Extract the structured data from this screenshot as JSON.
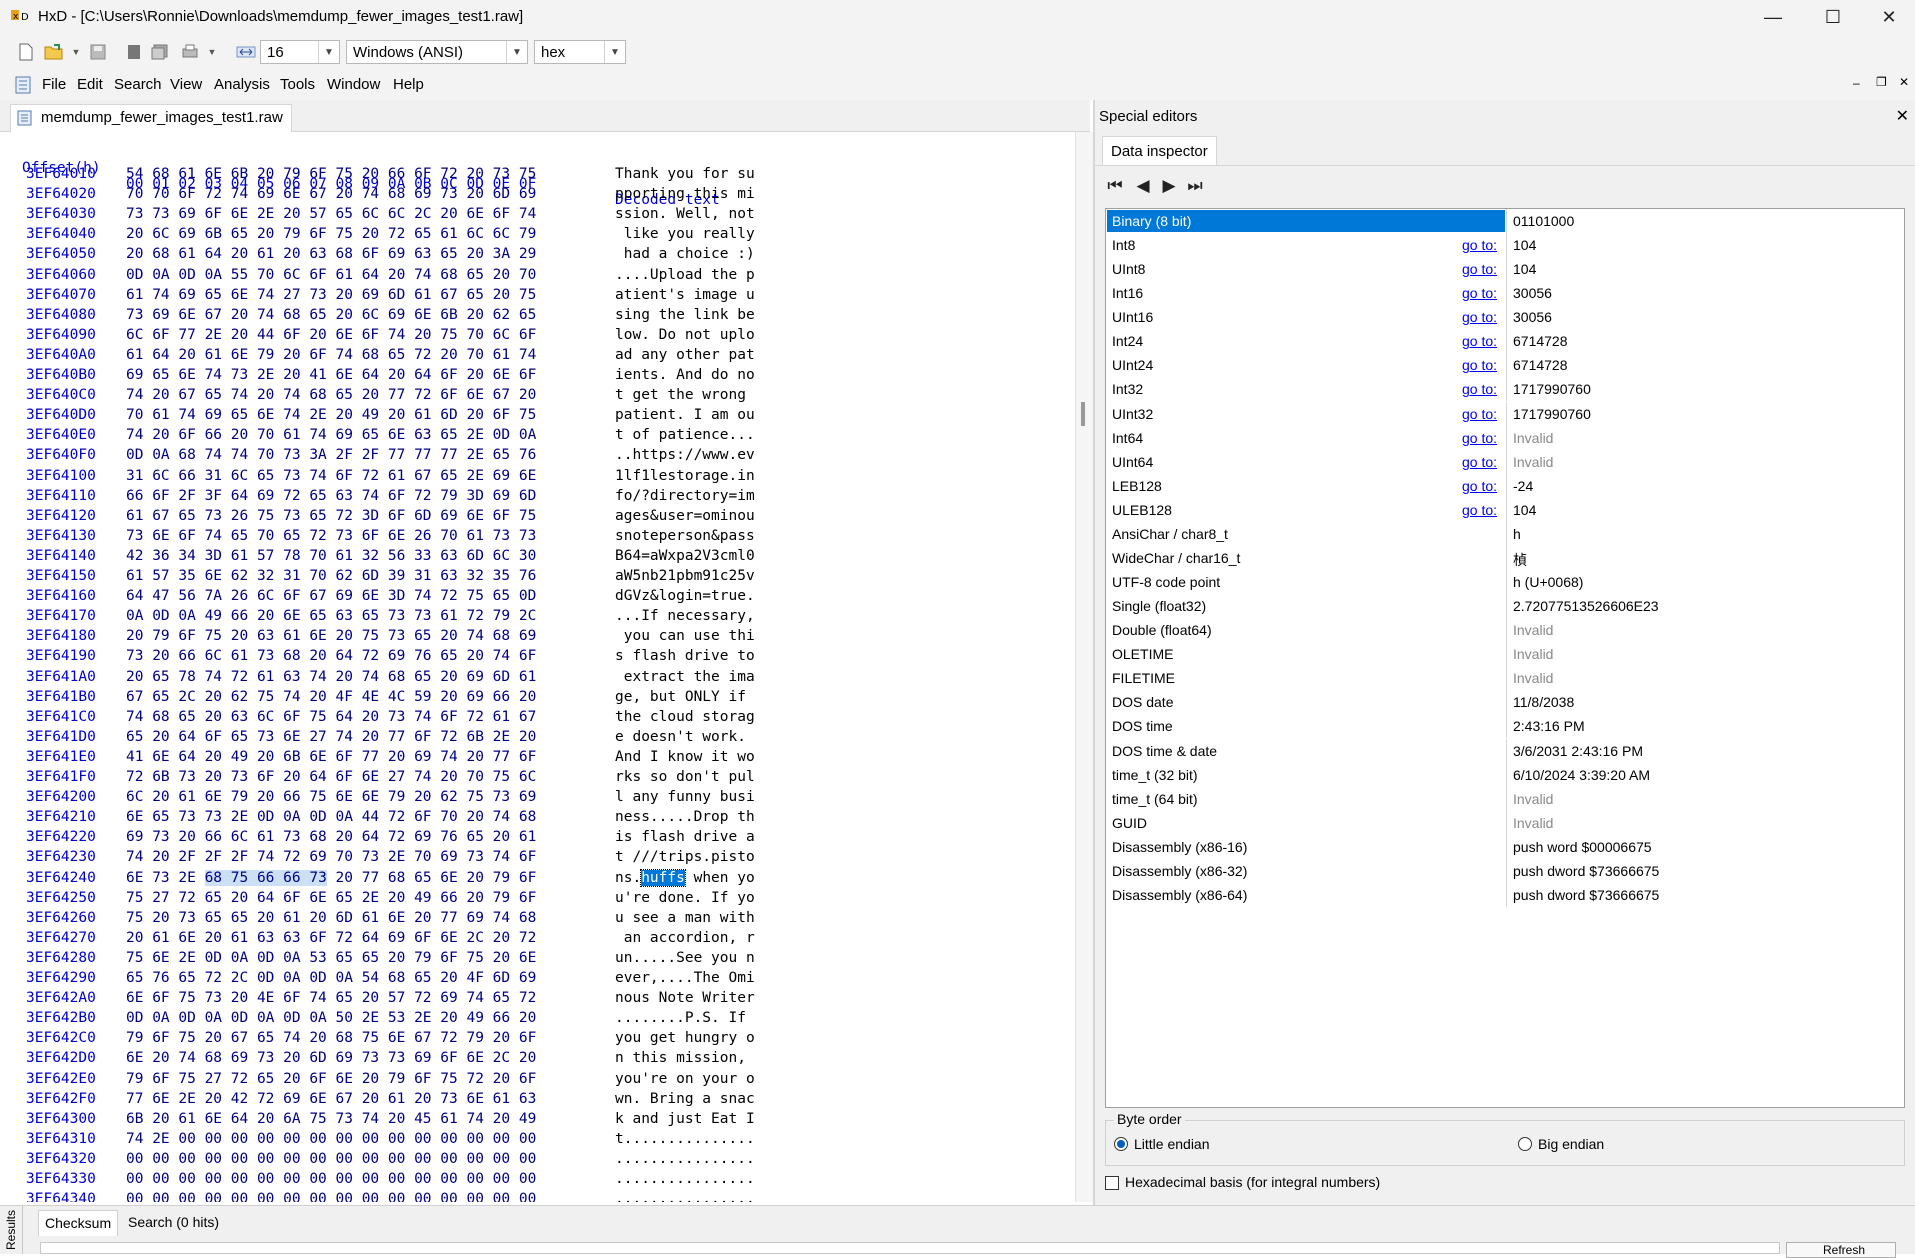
{
  "window": {
    "title": "HxD - [C:\\Users\\Ronnie\\Downloads\\memdump_fewer_images_test1.raw]",
    "minimize": "—",
    "maximize": "☐",
    "close": "✕"
  },
  "toolbar": {
    "bytes_per_row": "16",
    "charset": "Windows (ANSI)",
    "display_mode": "hex"
  },
  "menu": [
    "File",
    "Edit",
    "Search",
    "View",
    "Analysis",
    "Tools",
    "Window",
    "Help"
  ],
  "doc_tab": "memdump_fewer_images_test1.raw",
  "hex": {
    "offset_header": "Offset(h)",
    "column_headers": [
      "00",
      "01",
      "02",
      "03",
      "04",
      "05",
      "06",
      "07",
      "08",
      "09",
      "0A",
      "0B",
      "0C",
      "0D",
      "0E",
      "0F"
    ],
    "decoded_header": "Decoded text",
    "rows": [
      {
        "offset": "3EF64010",
        "hex": "54 68 61 6E 6B 20 79 6F 75 20 66 6F 72 20 73 75",
        "text": "Thank you for su"
      },
      {
        "offset": "3EF64020",
        "hex": "70 70 6F 72 74 69 6E 67 20 74 68 69 73 20 6D 69",
        "text": "pporting this mi"
      },
      {
        "offset": "3EF64030",
        "hex": "73 73 69 6F 6E 2E 20 57 65 6C 6C 2C 20 6E 6F 74",
        "text": "ssion. Well, not"
      },
      {
        "offset": "3EF64040",
        "hex": "20 6C 69 6B 65 20 79 6F 75 20 72 65 61 6C 6C 79",
        "text": " like you really"
      },
      {
        "offset": "3EF64050",
        "hex": "20 68 61 64 20 61 20 63 68 6F 69 63 65 20 3A 29",
        "text": " had a choice :)"
      },
      {
        "offset": "3EF64060",
        "hex": "0D 0A 0D 0A 55 70 6C 6F 61 64 20 74 68 65 20 70",
        "text": "....Upload the p"
      },
      {
        "offset": "3EF64070",
        "hex": "61 74 69 65 6E 74 27 73 20 69 6D 61 67 65 20 75",
        "text": "atient's image u"
      },
      {
        "offset": "3EF64080",
        "hex": "73 69 6E 67 20 74 68 65 20 6C 69 6E 6B 20 62 65",
        "text": "sing the link be"
      },
      {
        "offset": "3EF64090",
        "hex": "6C 6F 77 2E 20 44 6F 20 6E 6F 74 20 75 70 6C 6F",
        "text": "low. Do not uplo"
      },
      {
        "offset": "3EF640A0",
        "hex": "61 64 20 61 6E 79 20 6F 74 68 65 72 20 70 61 74",
        "text": "ad any other pat"
      },
      {
        "offset": "3EF640B0",
        "hex": "69 65 6E 74 73 2E 20 41 6E 64 20 64 6F 20 6E 6F",
        "text": "ients. And do no"
      },
      {
        "offset": "3EF640C0",
        "hex": "74 20 67 65 74 20 74 68 65 20 77 72 6F 6E 67 20",
        "text": "t get the wrong "
      },
      {
        "offset": "3EF640D0",
        "hex": "70 61 74 69 65 6E 74 2E 20 49 20 61 6D 20 6F 75",
        "text": "patient. I am ou"
      },
      {
        "offset": "3EF640E0",
        "hex": "74 20 6F 66 20 70 61 74 69 65 6E 63 65 2E 0D 0A",
        "text": "t of patience..."
      },
      {
        "offset": "3EF640F0",
        "hex": "0D 0A 68 74 74 70 73 3A 2F 2F 77 77 77 2E 65 76",
        "text": "..https://www.ev"
      },
      {
        "offset": "3EF64100",
        "hex": "31 6C 66 31 6C 65 73 74 6F 72 61 67 65 2E 69 6E",
        "text": "1lf1lestorage.in"
      },
      {
        "offset": "3EF64110",
        "hex": "66 6F 2F 3F 64 69 72 65 63 74 6F 72 79 3D 69 6D",
        "text": "fo/?directory=im"
      },
      {
        "offset": "3EF64120",
        "hex": "61 67 65 73 26 75 73 65 72 3D 6F 6D 69 6E 6F 75",
        "text": "ages&user=ominou"
      },
      {
        "offset": "3EF64130",
        "hex": "73 6E 6F 74 65 70 65 72 73 6F 6E 26 70 61 73 73",
        "text": "snoteperson&pass"
      },
      {
        "offset": "3EF64140",
        "hex": "42 36 34 3D 61 57 78 70 61 32 56 33 63 6D 6C 30",
        "text": "B64=aWxpa2V3cml0"
      },
      {
        "offset": "3EF64150",
        "hex": "61 57 35 6E 62 32 31 70 62 6D 39 31 63 32 35 76",
        "text": "aW5nb21pbm91c25v"
      },
      {
        "offset": "3EF64160",
        "hex": "64 47 56 7A 26 6C 6F 67 69 6E 3D 74 72 75 65 0D",
        "text": "dGVz&login=true."
      },
      {
        "offset": "3EF64170",
        "hex": "0A 0D 0A 49 66 20 6E 65 63 65 73 73 61 72 79 2C",
        "text": "...If necessary,"
      },
      {
        "offset": "3EF64180",
        "hex": "20 79 6F 75 20 63 61 6E 20 75 73 65 20 74 68 69",
        "text": " you can use thi"
      },
      {
        "offset": "3EF64190",
        "hex": "73 20 66 6C 61 73 68 20 64 72 69 76 65 20 74 6F",
        "text": "s flash drive to"
      },
      {
        "offset": "3EF641A0",
        "hex": "20 65 78 74 72 61 63 74 20 74 68 65 20 69 6D 61",
        "text": " extract the ima"
      },
      {
        "offset": "3EF641B0",
        "hex": "67 65 2C 20 62 75 74 20 4F 4E 4C 59 20 69 66 20",
        "text": "ge, but ONLY if "
      },
      {
        "offset": "3EF641C0",
        "hex": "74 68 65 20 63 6C 6F 75 64 20 73 74 6F 72 61 67",
        "text": "the cloud storag"
      },
      {
        "offset": "3EF641D0",
        "hex": "65 20 64 6F 65 73 6E 27 74 20 77 6F 72 6B 2E 20",
        "text": "e doesn't work. "
      },
      {
        "offset": "3EF641E0",
        "hex": "41 6E 64 20 49 20 6B 6E 6F 77 20 69 74 20 77 6F",
        "text": "And I know it wo"
      },
      {
        "offset": "3EF641F0",
        "hex": "72 6B 73 20 73 6F 20 64 6F 6E 27 74 20 70 75 6C",
        "text": "rks so don't pul"
      },
      {
        "offset": "3EF64200",
        "hex": "6C 20 61 6E 79 20 66 75 6E 6E 79 20 62 75 73 69",
        "text": "l any funny busi"
      },
      {
        "offset": "3EF64210",
        "hex": "6E 65 73 73 2E 0D 0A 0D 0A 44 72 6F 70 20 74 68",
        "text": "ness.....Drop th"
      },
      {
        "offset": "3EF64220",
        "hex": "69 73 20 66 6C 61 73 68 20 64 72 69 76 65 20 61",
        "text": "is flash drive a"
      },
      {
        "offset": "3EF64230",
        "hex": "74 20 2F 2F 2F 74 72 69 70 73 2E 70 69 73 74 6F",
        "text": "t ///trips.pisto"
      },
      {
        "offset": "3EF64240",
        "hex": "6E 73 2E 68 75 66 66 73 20 77 68 65 6E 20 79 6F",
        "text": "ns.huffs when yo",
        "sel_start": 3,
        "sel_len": 5
      },
      {
        "offset": "3EF64250",
        "hex": "75 27 72 65 20 64 6F 6E 65 2E 20 49 66 20 79 6F",
        "text": "u're done. If yo"
      },
      {
        "offset": "3EF64260",
        "hex": "75 20 73 65 65 20 61 20 6D 61 6E 20 77 69 74 68",
        "text": "u see a man with"
      },
      {
        "offset": "3EF64270",
        "hex": "20 61 6E 20 61 63 63 6F 72 64 69 6F 6E 2C 20 72",
        "text": " an accordion, r"
      },
      {
        "offset": "3EF64280",
        "hex": "75 6E 2E 0D 0A 0D 0A 53 65 65 20 79 6F 75 20 6E",
        "text": "un.....See you n"
      },
      {
        "offset": "3EF64290",
        "hex": "65 76 65 72 2C 0D 0A 0D 0A 54 68 65 20 4F 6D 69",
        "text": "ever,....The Omi"
      },
      {
        "offset": "3EF642A0",
        "hex": "6E 6F 75 73 20 4E 6F 74 65 20 57 72 69 74 65 72",
        "text": "nous Note Writer"
      },
      {
        "offset": "3EF642B0",
        "hex": "0D 0A 0D 0A 0D 0A 0D 0A 50 2E 53 2E 20 49 66 20",
        "text": "........P.S. If "
      },
      {
        "offset": "3EF642C0",
        "hex": "79 6F 75 20 67 65 74 20 68 75 6E 67 72 79 20 6F",
        "text": "you get hungry o"
      },
      {
        "offset": "3EF642D0",
        "hex": "6E 20 74 68 69 73 20 6D 69 73 73 69 6F 6E 2C 20",
        "text": "n this mission, "
      },
      {
        "offset": "3EF642E0",
        "hex": "79 6F 75 27 72 65 20 6F 6E 20 79 6F 75 72 20 6F",
        "text": "you're on your o"
      },
      {
        "offset": "3EF642F0",
        "hex": "77 6E 2E 20 42 72 69 6E 67 20 61 20 73 6E 61 63",
        "text": "wn. Bring a snac"
      },
      {
        "offset": "3EF64300",
        "hex": "6B 20 61 6E 64 20 6A 75 73 74 20 45 61 74 20 49",
        "text": "k and just Eat I"
      },
      {
        "offset": "3EF64310",
        "hex": "74 2E 00 00 00 00 00 00 00 00 00 00 00 00 00 00",
        "text": "t..............."
      },
      {
        "offset": "3EF64320",
        "hex": "00 00 00 00 00 00 00 00 00 00 00 00 00 00 00 00",
        "text": "................"
      },
      {
        "offset": "3EF64330",
        "hex": "00 00 00 00 00 00 00 00 00 00 00 00 00 00 00 00",
        "text": "................"
      },
      {
        "offset": "3EF64340",
        "hex": "00 00 00 00 00 00 00 00 00 00 00 00 00 00 00 00",
        "text": "................"
      }
    ]
  },
  "special_editors": {
    "title": "Special editors",
    "close": "✕",
    "tab": "Data inspector",
    "go_to": "go to:",
    "rows": [
      {
        "name": "Binary (8 bit)",
        "value": "01101000",
        "goto": false,
        "selected": true
      },
      {
        "name": "Int8",
        "value": "104",
        "goto": true
      },
      {
        "name": "UInt8",
        "value": "104",
        "goto": true
      },
      {
        "name": "Int16",
        "value": "30056",
        "goto": true
      },
      {
        "name": "UInt16",
        "value": "30056",
        "goto": true
      },
      {
        "name": "Int24",
        "value": "6714728",
        "goto": true
      },
      {
        "name": "UInt24",
        "value": "6714728",
        "goto": true
      },
      {
        "name": "Int32",
        "value": "1717990760",
        "goto": true
      },
      {
        "name": "UInt32",
        "value": "1717990760",
        "goto": true
      },
      {
        "name": "Int64",
        "value": "Invalid",
        "goto": true,
        "invalid": true
      },
      {
        "name": "UInt64",
        "value": "Invalid",
        "goto": true,
        "invalid": true
      },
      {
        "name": "LEB128",
        "value": "-24",
        "goto": true
      },
      {
        "name": "ULEB128",
        "value": "104",
        "goto": true
      },
      {
        "name": "AnsiChar / char8_t",
        "value": "h",
        "goto": false
      },
      {
        "name": "WideChar / char16_t",
        "value": "楨",
        "goto": false
      },
      {
        "name": "UTF-8 code point",
        "value": "h (U+0068)",
        "goto": false
      },
      {
        "name": "Single (float32)",
        "value": "2.72077513526606E23",
        "goto": false
      },
      {
        "name": "Double (float64)",
        "value": "Invalid",
        "goto": false,
        "invalid": true
      },
      {
        "name": "OLETIME",
        "value": "Invalid",
        "goto": false,
        "invalid": true
      },
      {
        "name": "FILETIME",
        "value": "Invalid",
        "goto": false,
        "invalid": true
      },
      {
        "name": "DOS date",
        "value": "11/8/2038",
        "goto": false
      },
      {
        "name": "DOS time",
        "value": "2:43:16 PM",
        "goto": false
      },
      {
        "name": "DOS time & date",
        "value": "3/6/2031 2:43:16 PM",
        "goto": false
      },
      {
        "name": "time_t (32 bit)",
        "value": "6/10/2024 3:39:20 AM",
        "goto": false
      },
      {
        "name": "time_t (64 bit)",
        "value": "Invalid",
        "goto": false,
        "invalid": true
      },
      {
        "name": "GUID",
        "value": "Invalid",
        "goto": false,
        "invalid": true
      },
      {
        "name": "Disassembly (x86-16)",
        "value": "push word $00006675",
        "goto": false
      },
      {
        "name": "Disassembly (x86-32)",
        "value": "push dword $73666675",
        "goto": false
      },
      {
        "name": "Disassembly (x86-64)",
        "value": "push dword $73666675",
        "goto": false
      }
    ],
    "byte_order_label": "Byte order",
    "little_endian": "Little endian",
    "big_endian": "Big endian",
    "hex_basis": "Hexadecimal basis (for integral numbers)"
  },
  "bottom": {
    "side_label": "Results",
    "tabs": [
      "Checksum",
      "Search (0 hits)"
    ],
    "refresh": "Refresh"
  },
  "colors": {
    "accent": "#0078d7",
    "offset_blue": "#0000cc",
    "link": "#0000ee"
  }
}
